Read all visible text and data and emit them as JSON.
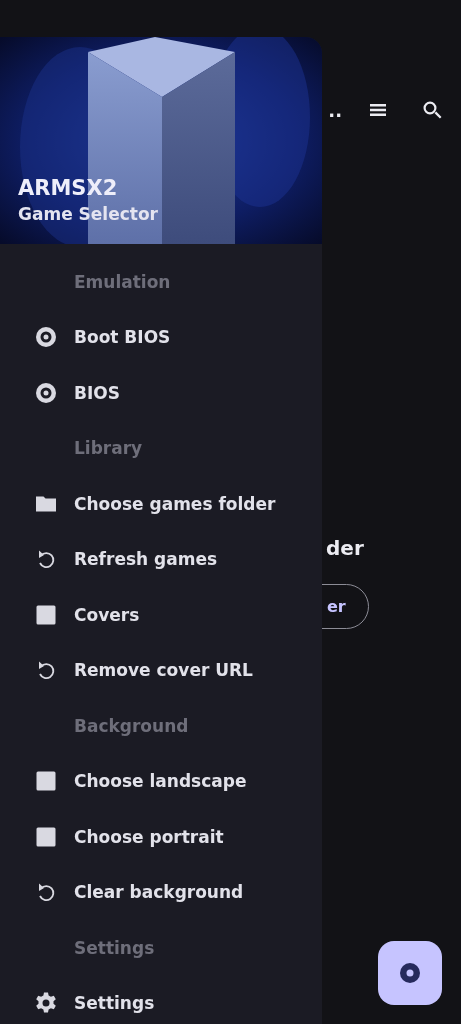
{
  "app_bar": {
    "title_fragment": ".."
  },
  "content": {
    "heading_fragment": "der",
    "button_fragment": "er"
  },
  "drawer": {
    "header": {
      "kind": "picture",
      "title": "ARMSX2",
      "subtitle": "Game Selector"
    },
    "items": [
      {
        "kind": "section",
        "label": "Emulation"
      },
      {
        "kind": "disc",
        "label": "Boot BIOS"
      },
      {
        "kind": "disc",
        "label": "BIOS"
      },
      {
        "kind": "section",
        "label": "Library"
      },
      {
        "kind": "folder",
        "label": "Choose games folder"
      },
      {
        "kind": "refresh",
        "label": "Refresh games"
      },
      {
        "kind": "square",
        "label": "Covers"
      },
      {
        "kind": "refresh",
        "label": "Remove cover URL"
      },
      {
        "kind": "section",
        "label": "Background"
      },
      {
        "kind": "square",
        "label": "Choose landscape"
      },
      {
        "kind": "square",
        "label": "Choose portrait"
      },
      {
        "kind": "refresh",
        "label": "Clear background"
      },
      {
        "kind": "section",
        "label": "Settings"
      },
      {
        "kind": "gear",
        "label": "Settings"
      }
    ]
  }
}
